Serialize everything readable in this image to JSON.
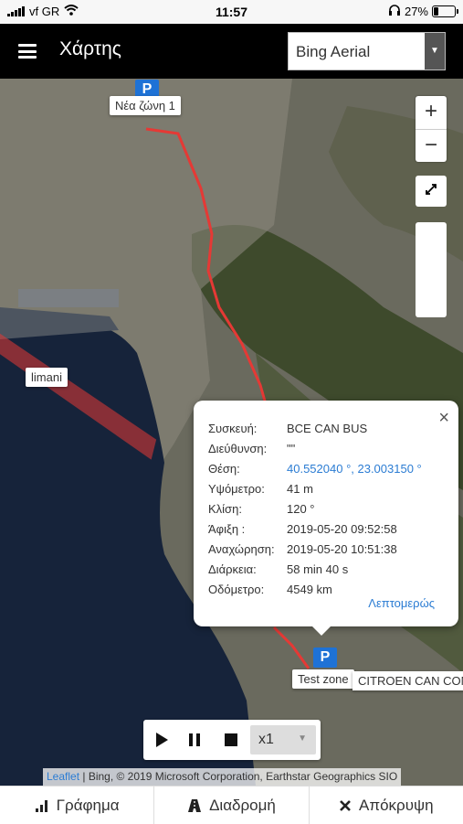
{
  "status_bar": {
    "carrier": "vf GR",
    "time": "11:57",
    "battery_text": "27%",
    "battery_level": 0.27
  },
  "app_bar": {
    "title": "Χάρτης",
    "layer_select": "Bing Aerial"
  },
  "map": {
    "zoom_in": "+",
    "zoom_out": "−",
    "labels": {
      "zone_top": "Νέα ζώνη 1",
      "limani": "limani",
      "test_zone": "Test zone",
      "vehicle": "CITROEN CAN CON"
    },
    "parking_marker": "P"
  },
  "popup": {
    "rows": [
      {
        "key": "Συσκευή:",
        "value": "BCE CAN BUS"
      },
      {
        "key": "Διεύθυνση:",
        "value": "\"\""
      },
      {
        "key": "Θέση:",
        "value": "40.552040 °, 23.003150 °"
      },
      {
        "key": "Υψόμετρο:",
        "value": "41 m"
      },
      {
        "key": "Κλίση:",
        "value": "120 °"
      },
      {
        "key": "Άφιξη :",
        "value": "2019-05-20 09:52:58"
      },
      {
        "key": "Αναχώρηση:",
        "value": "2019-05-20 10:51:38"
      },
      {
        "key": "Διάρκεια:",
        "value": "58 min 40 s"
      },
      {
        "key": "Οδόμετρο:",
        "value": "4549 km"
      }
    ],
    "details_link": "Λεπτομερώς",
    "close": "×"
  },
  "playback": {
    "speed": "x1"
  },
  "attribution": {
    "leaflet": "Leaflet",
    "text": " | Bing, © 2019 Microsoft Corporation, Earthstar Geographics SIO"
  },
  "bottom_bar": {
    "graph": "Γράφημα",
    "route": "Διαδρομή",
    "hide": "Απόκρυψη"
  },
  "colors": {
    "route": "#e53935",
    "marker": "#1e72d6",
    "link": "#2b7cd3"
  }
}
